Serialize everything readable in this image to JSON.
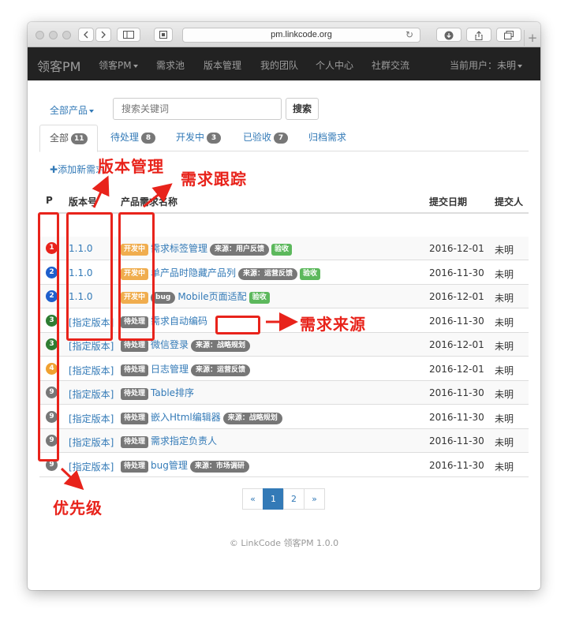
{
  "browser": {
    "url": "pm.linkcode.org"
  },
  "navbar": {
    "brand": "领客PM",
    "items": [
      "领客PM",
      "需求池",
      "版本管理",
      "我的团队",
      "个人中心",
      "社群交流"
    ],
    "current_user": "当前用户：未明"
  },
  "search": {
    "product_filter": "全部产品",
    "placeholder": "搜索关键词",
    "button": "搜索"
  },
  "tabs": [
    {
      "label": "全部",
      "count": "11"
    },
    {
      "label": "待处理",
      "count": "8"
    },
    {
      "label": "开发中",
      "count": "3"
    },
    {
      "label": "已验收",
      "count": "7"
    },
    {
      "label": "归档需求",
      "count": ""
    }
  ],
  "add_requirement": "添加新需求",
  "table": {
    "headers": [
      "P",
      "版本号",
      "产品需求名称",
      "提交日期",
      "提交人"
    ],
    "rows": [
      {
        "priority": "1",
        "version": "1.1.0",
        "status": "开发中",
        "bug": "",
        "title": "需求标签管理",
        "source": "来源：用户反馈",
        "accepted": "验收",
        "date": "2016-12-01",
        "submitter": "未明"
      },
      {
        "priority": "2",
        "version": "1.1.0",
        "status": "开发中",
        "bug": "",
        "title": "单产品时隐藏产品列",
        "source": "来源：运营反馈",
        "accepted": "验收",
        "date": "2016-11-30",
        "submitter": "未明"
      },
      {
        "priority": "2",
        "version": "1.1.0",
        "status": "开发中",
        "bug": "bug",
        "title": "Mobile页面适配",
        "source": "",
        "accepted": "验收",
        "date": "2016-12-01",
        "submitter": "未明"
      },
      {
        "priority": "3",
        "version": "[指定版本]",
        "status": "待处理",
        "bug": "",
        "title": "需求自动编码",
        "source": "",
        "accepted": "",
        "date": "2016-11-30",
        "submitter": "未明"
      },
      {
        "priority": "3",
        "version": "[指定版本]",
        "status": "待处理",
        "bug": "",
        "title": "微信登录",
        "source": "来源：战略规划",
        "accepted": "",
        "date": "2016-12-01",
        "submitter": "未明"
      },
      {
        "priority": "4",
        "version": "[指定版本]",
        "status": "待处理",
        "bug": "",
        "title": "日志管理",
        "source": "来源：运营反馈",
        "accepted": "",
        "date": "2016-12-01",
        "submitter": "未明"
      },
      {
        "priority": "9",
        "version": "[指定版本]",
        "status": "待处理",
        "bug": "",
        "title": "Table排序",
        "source": "",
        "accepted": "",
        "date": "2016-11-30",
        "submitter": "未明"
      },
      {
        "priority": "9",
        "version": "[指定版本]",
        "status": "待处理",
        "bug": "",
        "title": "嵌入Html编辑器",
        "source": "来源：战略规划",
        "accepted": "",
        "date": "2016-11-30",
        "submitter": "未明"
      },
      {
        "priority": "9",
        "version": "[指定版本]",
        "status": "待处理",
        "bug": "",
        "title": "需求指定负责人",
        "source": "",
        "accepted": "",
        "date": "2016-11-30",
        "submitter": "未明"
      },
      {
        "priority": "9",
        "version": "[指定版本]",
        "status": "待处理",
        "bug": "",
        "title": "bug管理",
        "source": "来源：市场调研",
        "accepted": "",
        "date": "2016-11-30",
        "submitter": "未明"
      }
    ]
  },
  "pagination": {
    "prev": "«",
    "pages": [
      "1",
      "2"
    ],
    "current": "1",
    "next": "»"
  },
  "footer": "© LinkCode 领客PM 1.0.0",
  "annotations": {
    "version_management": "版本管理",
    "requirement_tracking": "需求跟踪",
    "requirement_source": "需求来源",
    "priority": "优先级"
  },
  "colors": {
    "priority": {
      "1": "#e8231b",
      "2": "#1f5fcc",
      "3": "#2e7d32",
      "4": "#f0a030",
      "9": "#777777"
    },
    "status": {
      "开发中": "#f0ad4e",
      "待处理": "#777777"
    },
    "accepted": "#5cb85c",
    "annotation": "#e8231b",
    "link": "#337ab7"
  }
}
